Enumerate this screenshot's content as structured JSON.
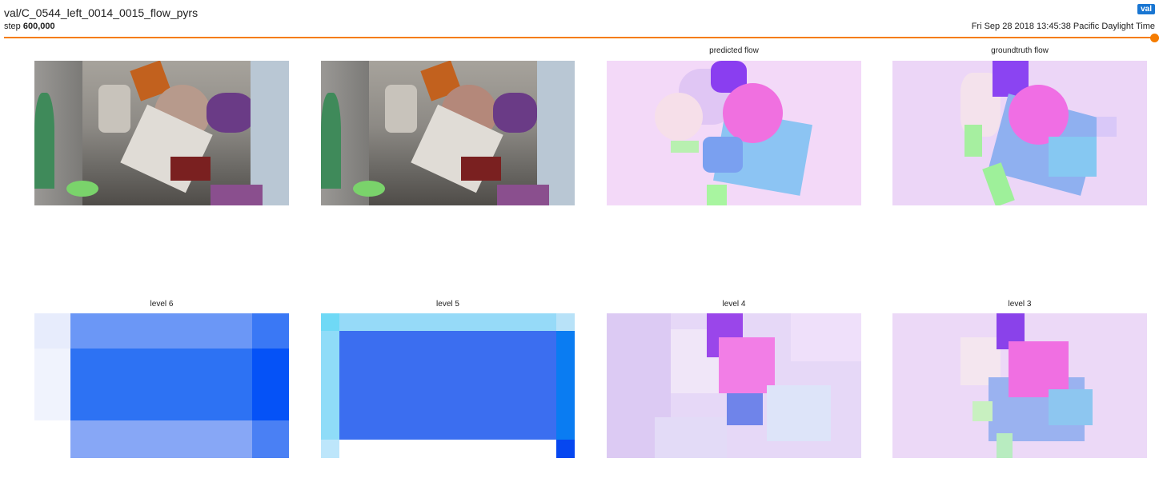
{
  "header": {
    "run_title": "val/C_0544_left_0014_0015_flow_pyrs",
    "step_label": "step",
    "step_value": "600,000",
    "badge": "val",
    "timestamp": "Fri Sep 28 2018 13:45:38 Pacific Daylight Time"
  },
  "slider": {
    "value_fraction": 1.0
  },
  "panels": [
    {
      "title": ""
    },
    {
      "title": ""
    },
    {
      "title": "predicted flow"
    },
    {
      "title": "groundtruth flow"
    },
    {
      "title": "level 6"
    },
    {
      "title": "level 5"
    },
    {
      "title": "level 4"
    },
    {
      "title": "level 3"
    }
  ],
  "colors": {
    "accent": "#f57c00",
    "badge": "#1976d2"
  }
}
